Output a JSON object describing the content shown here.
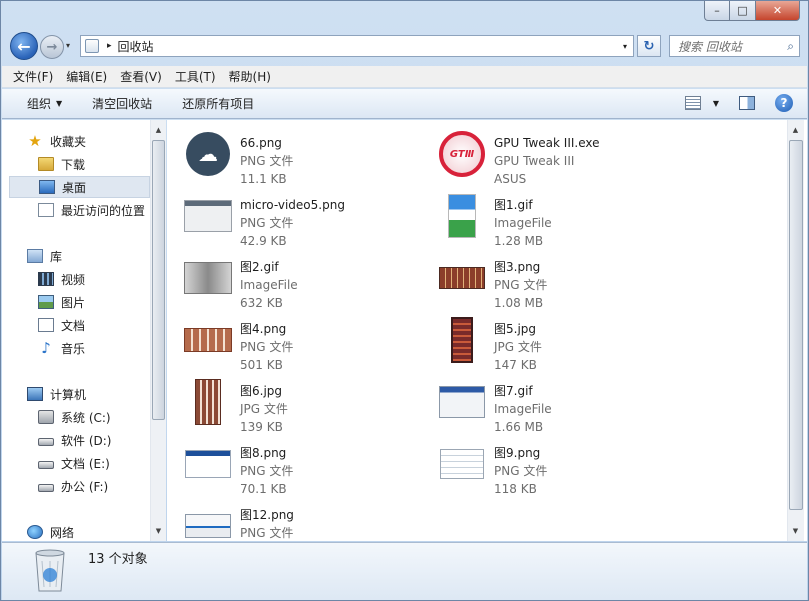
{
  "window": {
    "caption_buttons": {
      "minimize": "–",
      "maximize": "□",
      "close": "✕"
    }
  },
  "nav": {
    "back_glyph": "←",
    "forward_glyph": "→",
    "history_glyph": "▾",
    "address_sep": "▸",
    "address": "回收站",
    "address_drop": "▾",
    "refresh_glyph": "↻",
    "search_placeholder": "搜索 回收站",
    "search_icon_glyph": "⌕"
  },
  "menu": [
    "文件(F)",
    "编辑(E)",
    "查看(V)",
    "工具(T)",
    "帮助(H)"
  ],
  "toolbar": {
    "organize": "组织",
    "organize_arrow": "▼",
    "empty_bin": "清空回收站",
    "restore_all": "还原所有项目",
    "view_drop": "▼",
    "help": "?"
  },
  "sidebar": {
    "favorites": "收藏夹",
    "downloads": "下载",
    "desktop": "桌面",
    "recent": "最近访问的位置",
    "libraries": "库",
    "videos": "视频",
    "pictures": "图片",
    "documents": "文档",
    "music": "音乐",
    "computer": "计算机",
    "drive_c": "系统 (C:)",
    "drive_d": "软件 (D:)",
    "drive_e": "文档 (E:)",
    "drive_f": "办公 (F:)",
    "network": "网络",
    "star_glyph": "★",
    "note_glyph": "♪",
    "scroll_up": "▲",
    "scroll_down": "▼"
  },
  "files": [
    {
      "name": "66.png",
      "type": "PNG 文件",
      "size": "11.1 KB",
      "thumb": "cloud-icon"
    },
    {
      "name": "GPU Tweak III.exe",
      "type": "GPU Tweak III",
      "size": "ASUS",
      "thumb": "gpu-tweak-icon"
    },
    {
      "name": "micro-video5.png",
      "type": "PNG 文件",
      "size": "42.9 KB",
      "thumb": "screen-thumb"
    },
    {
      "name": "图1.gif",
      "type": "ImageFile",
      "size": "1.28 MB",
      "thumb": "doc-thumb"
    },
    {
      "name": "图2.gif",
      "type": "ImageFile",
      "size": "632 KB",
      "thumb": "gray-thumb"
    },
    {
      "name": "图3.png",
      "type": "PNG 文件",
      "size": "1.08 MB",
      "thumb": "grid-thumb"
    },
    {
      "name": "图4.png",
      "type": "PNG 文件",
      "size": "501 KB",
      "thumb": "grid-thumb"
    },
    {
      "name": "图5.jpg",
      "type": "JPG 文件",
      "size": "147 KB",
      "thumb": "phone-thumb"
    },
    {
      "name": "图6.jpg",
      "type": "JPG 文件",
      "size": "139 KB",
      "thumb": "tall-thumb"
    },
    {
      "name": "图7.gif",
      "type": "ImageFile",
      "size": "1.66 MB",
      "thumb": "web-thumb"
    },
    {
      "name": "图8.png",
      "type": "PNG 文件",
      "size": "70.1 KB",
      "thumb": "web-thumb"
    },
    {
      "name": "图9.png",
      "type": "PNG 文件",
      "size": "118 KB",
      "thumb": "list-thumb"
    },
    {
      "name": "图12.png",
      "type": "PNG 文件",
      "size": "",
      "thumb": "web-thumb"
    }
  ],
  "thumbs": {
    "cloud_glyph": "☁",
    "gpu_text": "GTⅢ"
  },
  "details": {
    "count": "13 个对象"
  },
  "scroll": {
    "up": "▲",
    "down": "▼"
  }
}
